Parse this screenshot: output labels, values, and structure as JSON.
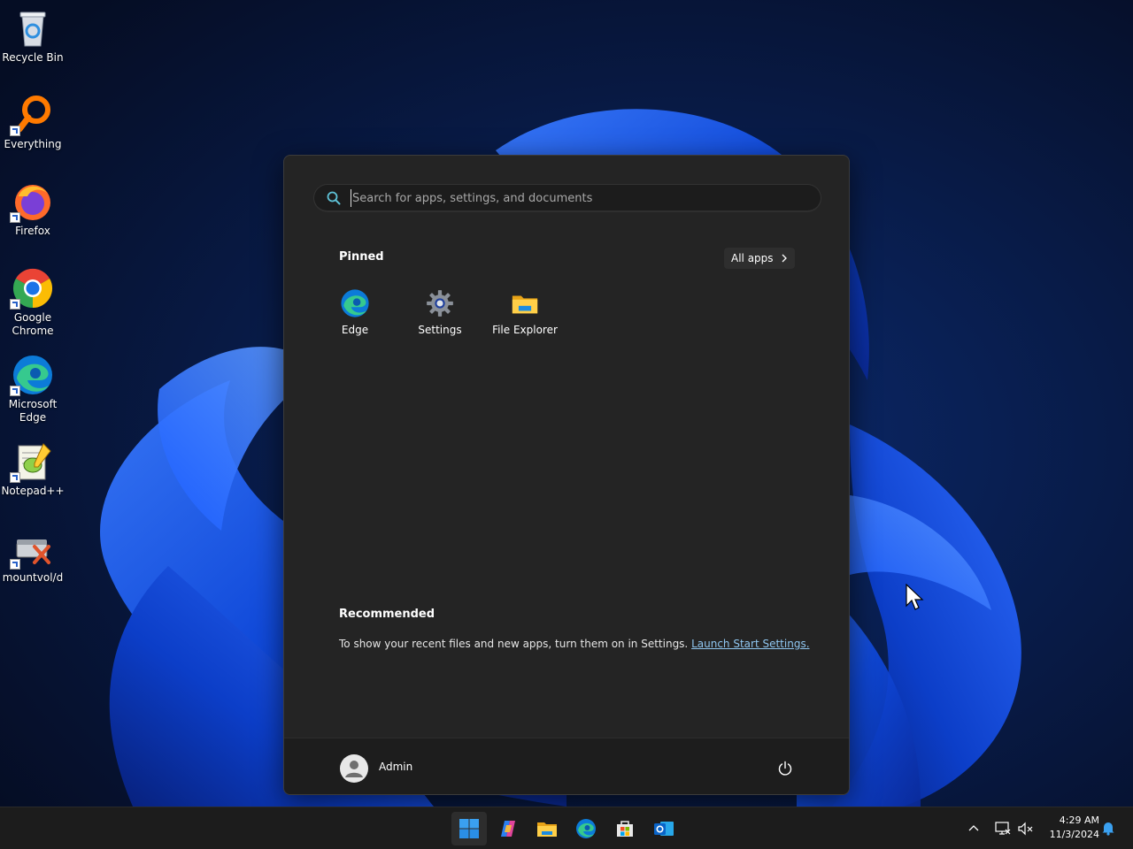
{
  "desktop": {
    "icons": [
      {
        "label": "Recycle Bin",
        "icon": "recycle-bin-icon"
      },
      {
        "label": "Everything",
        "icon": "everything-search-icon"
      },
      {
        "label": "Firefox",
        "icon": "firefox-icon"
      },
      {
        "label": "Google Chrome",
        "icon": "chrome-icon"
      },
      {
        "label": "Microsoft Edge",
        "icon": "edge-icon"
      },
      {
        "label": "Notepad++",
        "icon": "notepad-plus-plus-icon"
      },
      {
        "label": "mountvol/d",
        "icon": "drive-remove-icon"
      }
    ]
  },
  "start_menu": {
    "search": {
      "placeholder": "Search for apps, settings, and documents",
      "value": ""
    },
    "pinned_title": "Pinned",
    "all_apps_label": "All apps",
    "pinned": [
      {
        "label": "Edge",
        "icon": "edge-icon"
      },
      {
        "label": "Settings",
        "icon": "settings-gear-icon"
      },
      {
        "label": "File Explorer",
        "icon": "folder-icon"
      }
    ],
    "recommended_title": "Recommended",
    "recommended_text": "To show your recent files and new apps, turn them on in Settings.",
    "recommended_link": "Launch Start Settings.",
    "user_name": "Admin"
  },
  "taskbar": {
    "apps": [
      "start-windows-icon",
      "copilot-icon",
      "file-explorer-icon",
      "edge-icon",
      "microsoft-store-icon",
      "outlook-icon"
    ],
    "clock": {
      "time": "4:29 AM",
      "date": "11/3/2024"
    }
  },
  "colors": {
    "start_bg": "#242424",
    "taskbar_bg": "#1c1c1c",
    "accent": "#0078d4",
    "link": "#8fc6f0"
  }
}
